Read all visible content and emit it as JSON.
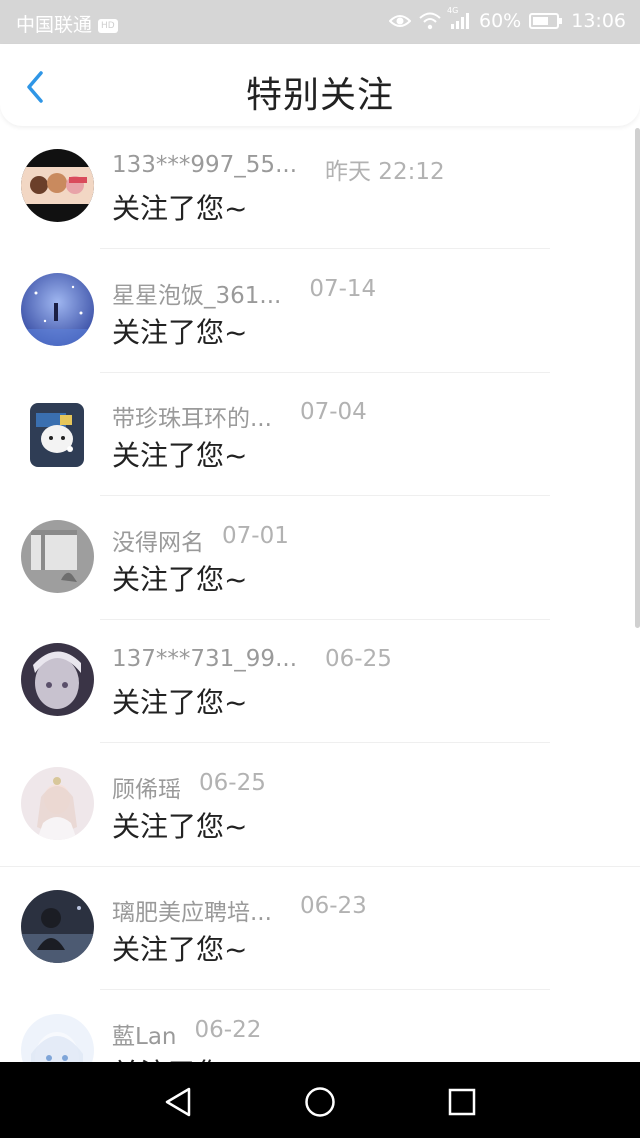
{
  "status_bar": {
    "carrier": "中国联通",
    "hd_badge": "HD",
    "network": "4G",
    "battery": "60%",
    "time": "13:06"
  },
  "header": {
    "title": "特别关注"
  },
  "items": [
    {
      "name": "133***997_55...",
      "time": "昨天 22:12",
      "message": "关注了您~",
      "avatar": "group-anime-avatar"
    },
    {
      "name": "星星泡饭_361...",
      "time": "07-14",
      "message": "关注了您~",
      "avatar": "starry-sky-avatar"
    },
    {
      "name": "带珍珠耳环的...",
      "time": "07-04",
      "message": "关注了您~",
      "avatar": "pearl-earring-avatar"
    },
    {
      "name": "没得网名",
      "time": "07-01",
      "message": "关注了您~",
      "avatar": "gray-window-avatar"
    },
    {
      "name": "137***731_99...",
      "time": "06-25",
      "message": "关注了您~",
      "avatar": "dark-anime-avatar"
    },
    {
      "name": "顾俙瑶",
      "time": "06-25",
      "message": "关注了您~",
      "avatar": "white-dress-avatar"
    },
    {
      "name": "璃肥美应聘培...",
      "time": "06-23",
      "message": "关注了您~",
      "avatar": "night-boy-avatar"
    },
    {
      "name": "藍Lan",
      "time": "06-22",
      "message": "关注了您~",
      "avatar": "white-hair-avatar"
    }
  ],
  "colors": {
    "accent": "#2f96e6",
    "status_bar_bg": "#d6d6d6",
    "name_text": "#9a9a9a",
    "message_text": "#222222",
    "nav_bar_bg": "#000000"
  }
}
